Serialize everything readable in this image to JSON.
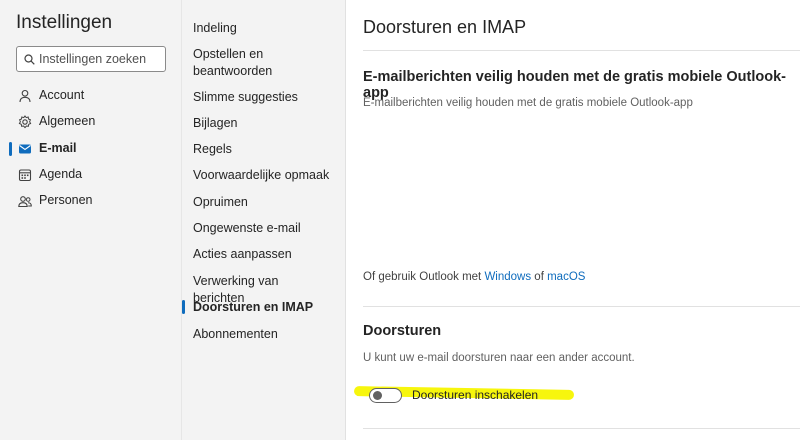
{
  "settings": {
    "title": "Instellingen",
    "search_placeholder": "Instellingen zoeken"
  },
  "nav": {
    "items": [
      {
        "label": "Account",
        "icon": "person-icon",
        "active": false
      },
      {
        "label": "Algemeen",
        "icon": "gear-icon",
        "active": false
      },
      {
        "label": "E-mail",
        "icon": "mail-icon",
        "active": true
      },
      {
        "label": "Agenda",
        "icon": "calendar-icon",
        "active": false
      },
      {
        "label": "Personen",
        "icon": "people-icon",
        "active": false
      }
    ]
  },
  "submenu": {
    "items": [
      {
        "label": "Indeling",
        "active": false
      },
      {
        "label": "Opstellen en beantwoorden",
        "active": false
      },
      {
        "label": "Slimme suggesties",
        "active": false
      },
      {
        "label": "Bijlagen",
        "active": false
      },
      {
        "label": "Regels",
        "active": false
      },
      {
        "label": "Voorwaardelijke opmaak",
        "active": false
      },
      {
        "label": "Opruimen",
        "active": false
      },
      {
        "label": "Ongewenste e-mail",
        "active": false
      },
      {
        "label": "Acties aanpassen",
        "active": false
      },
      {
        "label": "Verwerking van berichten",
        "active": false
      },
      {
        "label": "Doorsturen en IMAP",
        "active": true
      },
      {
        "label": "Abonnementen",
        "active": false
      }
    ]
  },
  "main": {
    "title": "Doorsturen en IMAP",
    "promo": {
      "heading": "E-mailberichten veilig houden met de gratis mobiele Outlook-app",
      "subtext": "E-mailberichten veilig houden met de gratis mobiele Outlook-app",
      "line_prefix": "Of gebruik Outlook met ",
      "link_windows": "Windows",
      "line_middle": " of ",
      "link_macos": "macOS"
    },
    "forwarding": {
      "heading": "Doorsturen",
      "description": "U kunt uw e-mail doorsturen naar een ander account.",
      "toggle_label": "Doorsturen inschakelen",
      "toggle_on": false
    }
  },
  "colors": {
    "accent": "#0f6cbd",
    "highlight": "#f7f600",
    "sidebar_bg": "#f3f3f3"
  }
}
